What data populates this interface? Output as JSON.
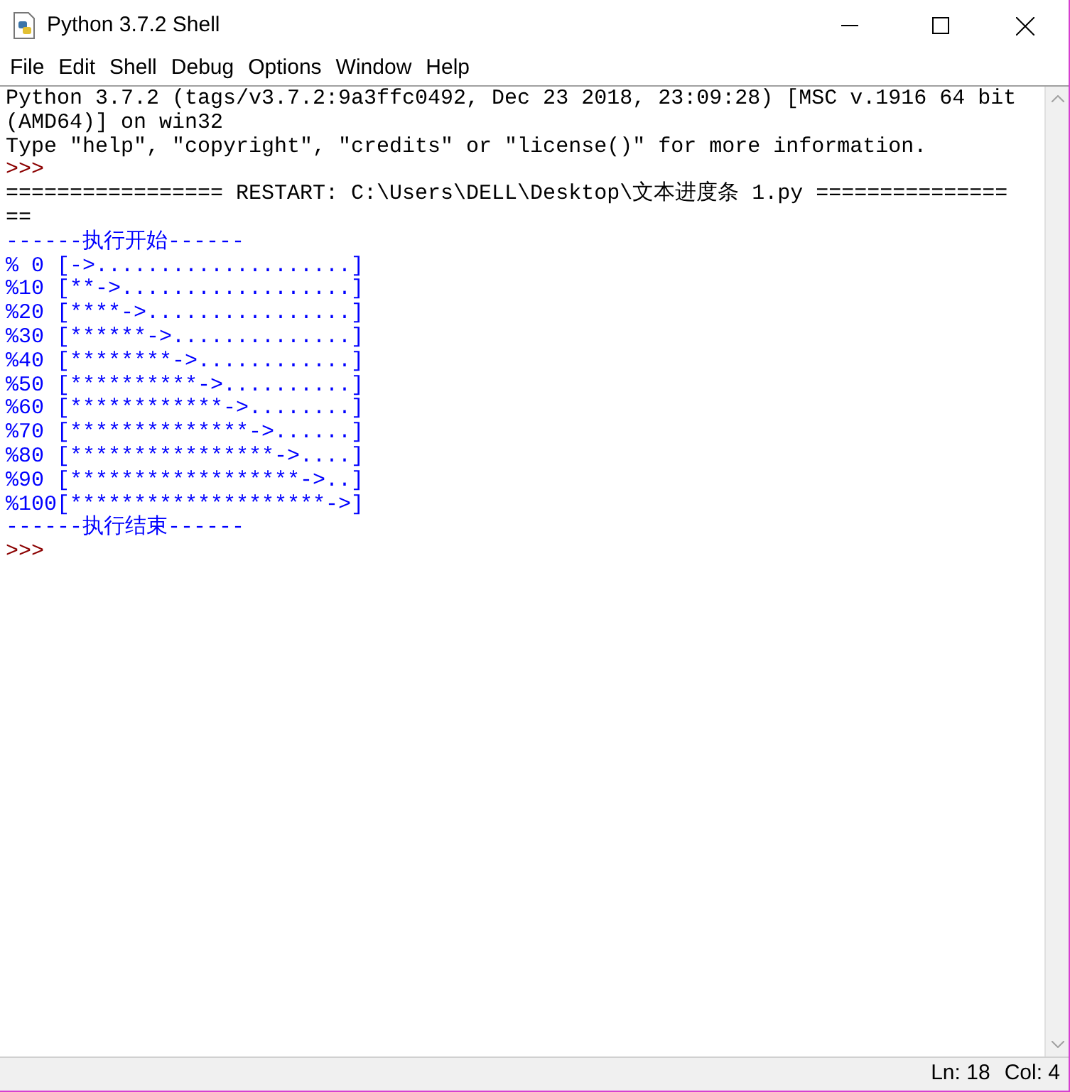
{
  "window": {
    "title": "Python 3.7.2 Shell"
  },
  "menu": [
    "File",
    "Edit",
    "Shell",
    "Debug",
    "Options",
    "Window",
    "Help"
  ],
  "lines": [
    {
      "kind": "output",
      "text": "Python 3.7.2 (tags/v3.7.2:9a3ffc0492, Dec 23 2018, 23:09:28) [MSC v.1916 64 bit"
    },
    {
      "kind": "output",
      "text": "(AMD64)] on win32"
    },
    {
      "kind": "output",
      "text": "Type \"help\", \"copyright\", \"credits\" or \"license()\" for more information."
    },
    {
      "kind": "prompt",
      "text": ">>>"
    },
    {
      "kind": "output",
      "text": "================= RESTART: C:\\Users\\DELL\\Desktop\\文本进度条 1.py ==============="
    },
    {
      "kind": "output",
      "text": "=="
    },
    {
      "kind": "stdout",
      "text": "------执行开始------"
    },
    {
      "kind": "stdout",
      "text": "% 0 [->....................]"
    },
    {
      "kind": "stdout",
      "text": "%10 [**->..................]"
    },
    {
      "kind": "stdout",
      "text": "%20 [****->................]"
    },
    {
      "kind": "stdout",
      "text": "%30 [******->..............]"
    },
    {
      "kind": "stdout",
      "text": "%40 [********->............]"
    },
    {
      "kind": "stdout",
      "text": "%50 [**********->..........]"
    },
    {
      "kind": "stdout",
      "text": "%60 [************->........]"
    },
    {
      "kind": "stdout",
      "text": "%70 [**************->......]"
    },
    {
      "kind": "stdout",
      "text": "%80 [****************->....]"
    },
    {
      "kind": "stdout",
      "text": "%90 [******************->..]"
    },
    {
      "kind": "stdout",
      "text": "%100[********************->]"
    },
    {
      "kind": "stdout",
      "text": "------执行结束------"
    },
    {
      "kind": "prompt",
      "text": ">>>"
    }
  ],
  "status_bar": {
    "line": "Ln: 18",
    "column": "Col: 4"
  }
}
